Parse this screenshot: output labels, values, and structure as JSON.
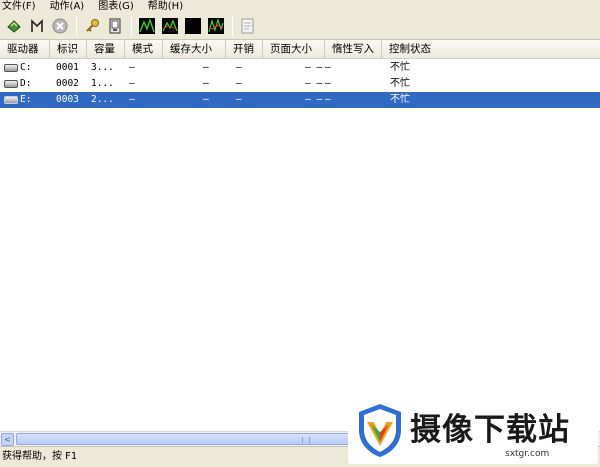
{
  "menu": [
    "文件(F)",
    "动作(A)",
    "图表(G)",
    "帮助(H)"
  ],
  "toolbar": [
    "refresh-icon",
    "meter-icon",
    "stop-icon",
    "key-icon",
    "device-icon",
    "graph-icon",
    "line-graph-icon",
    "black-graph-icon",
    "multi-graph-icon",
    "properties-icon"
  ],
  "columns": [
    "驱动器",
    "标识",
    "容量",
    "模式",
    "缓存大小",
    "开销",
    "页面大小",
    "惰性写入",
    "控制状态"
  ],
  "rows": [
    {
      "drive": "C:",
      "id": "0001",
      "capacity": "3...",
      "mode": "–",
      "cache": "–",
      "overhead": "–",
      "page_size": "–  –",
      "lazy": "–",
      "status": "不忙",
      "selected": false
    },
    {
      "drive": "D:",
      "id": "0002",
      "capacity": "1...",
      "mode": "–",
      "cache": "–",
      "overhead": "–",
      "page_size": "–  –",
      "lazy": "–",
      "status": "不忙",
      "selected": false
    },
    {
      "drive": "E:",
      "id": "0003",
      "capacity": "2...",
      "mode": "–",
      "cache": "–",
      "overhead": "–",
      "page_size": "–  –",
      "lazy": "–",
      "status": "不忙",
      "selected": true
    }
  ],
  "scrollbar": {
    "left_arrow": "<",
    "grip": "|||"
  },
  "status_text": "获得帮助，按 F1",
  "watermark": {
    "title": "摄像下载站",
    "url": "sxtgr.com"
  },
  "colors": {
    "selection": "#316ac5",
    "chrome": "#ece9d8"
  }
}
